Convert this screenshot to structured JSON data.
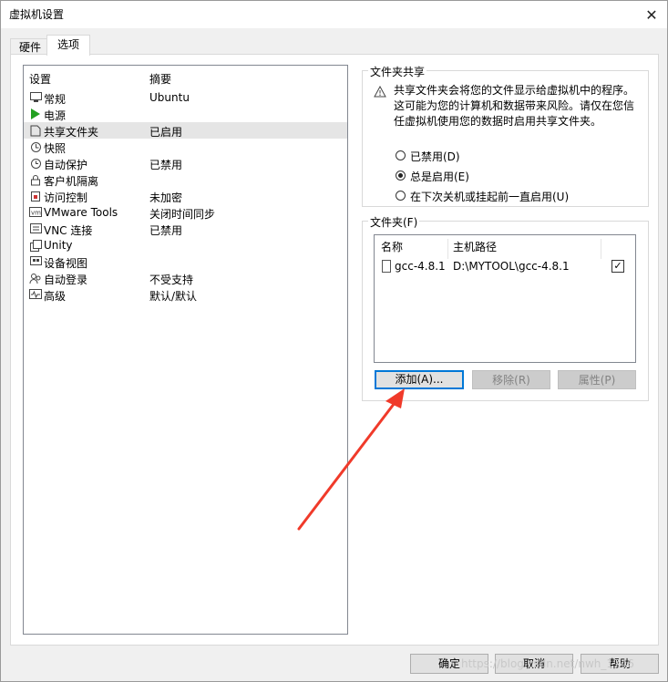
{
  "window": {
    "title": "虚拟机设置",
    "close_glyph": "✕"
  },
  "tabs": [
    {
      "label": "硬件"
    },
    {
      "label": "选项"
    }
  ],
  "settings_list": {
    "headers": {
      "setting": "设置",
      "summary": "摘要"
    },
    "items": [
      {
        "name": "常规",
        "summary": "Ubuntu",
        "icon": "monitor-icon"
      },
      {
        "name": "电源",
        "summary": "",
        "icon": "power-play-icon"
      },
      {
        "name": "共享文件夹",
        "summary": "已启用",
        "icon": "shared-folder-icon",
        "selected": true
      },
      {
        "name": "快照",
        "summary": "",
        "icon": "snapshot-icon"
      },
      {
        "name": "自动保护",
        "summary": "已禁用",
        "icon": "clock-icon"
      },
      {
        "name": "客户机隔离",
        "summary": "",
        "icon": "lock-icon"
      },
      {
        "name": "访问控制",
        "summary": "未加密",
        "icon": "access-control-icon"
      },
      {
        "name": "VMware Tools",
        "summary": "关闭时间同步",
        "icon": "vm-icon"
      },
      {
        "name": "VNC 连接",
        "summary": "已禁用",
        "icon": "vnc-icon"
      },
      {
        "name": "Unity",
        "summary": "",
        "icon": "unity-icon"
      },
      {
        "name": "设备视图",
        "summary": "",
        "icon": "device-view-icon"
      },
      {
        "name": "自动登录",
        "summary": "不受支持",
        "icon": "users-icon"
      },
      {
        "name": "高级",
        "summary": "默认/默认",
        "icon": "advanced-icon"
      }
    ]
  },
  "folder_sharing": {
    "legend": "文件夹共享",
    "warning": "共享文件夹会将您的文件显示给虚拟机中的程序。这可能为您的计算机和数据带来风险。请仅在您信任虚拟机使用您的数据时启用共享文件夹。",
    "options": [
      {
        "label": "已禁用(D)",
        "checked": false
      },
      {
        "label": "总是启用(E)",
        "checked": true
      },
      {
        "label": "在下次关机或挂起前一直启用(U)",
        "checked": false
      }
    ]
  },
  "folders": {
    "legend": "文件夹(F)",
    "columns": {
      "name": "名称",
      "host_path": "主机路径"
    },
    "rows": [
      {
        "name": "gcc-4.8.1",
        "host_path": "D:\\MYTOOL\\gcc-4.8.1",
        "enabled": true,
        "check_glyph": "✓"
      }
    ],
    "buttons": {
      "add": "添加(A)...",
      "remove": "移除(R)",
      "properties": "属性(P)"
    }
  },
  "footer": {
    "ok": "确定",
    "cancel": "取消",
    "help": "帮助"
  },
  "watermark": "https://blog.csdn.net/nwh_1746",
  "colors": {
    "arrow": "#f03a2a",
    "selection": "#e5e5e5",
    "focus": "#0078d7"
  }
}
